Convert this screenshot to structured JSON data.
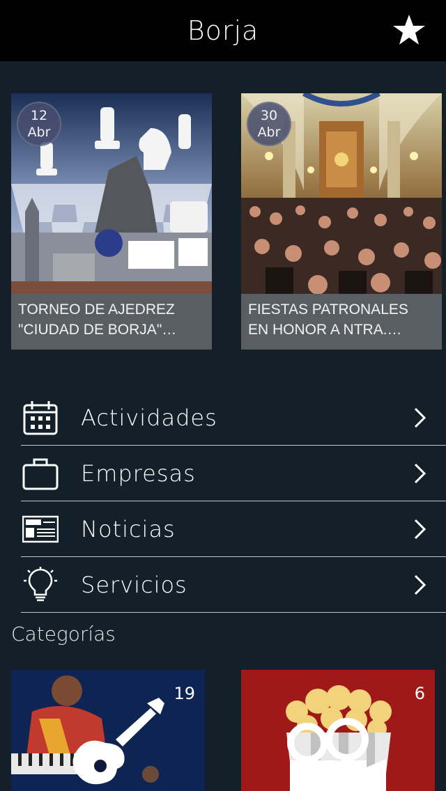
{
  "header": {
    "title": "Borja",
    "favorite_icon": "star-icon"
  },
  "events": [
    {
      "day": "12",
      "month": "Abr",
      "title": "TORNEO DE AJEDREZ\n\"CIUDAD DE BORJA\"…"
    },
    {
      "day": "30",
      "month": "Abr",
      "title": "FIESTAS PATRONALES\nEN HONOR A NTRA.…"
    }
  ],
  "menu": [
    {
      "label": "Actividades",
      "icon": "calendar-icon"
    },
    {
      "label": "Empresas",
      "icon": "briefcase-icon"
    },
    {
      "label": "Noticias",
      "icon": "newspaper-icon"
    },
    {
      "label": "Servicios",
      "icon": "lightbulb-icon"
    }
  ],
  "categories_title": "Categorías",
  "categories": [
    {
      "count": "19",
      "icon": "guitar-icon"
    },
    {
      "count": "6",
      "icon": "movie-camera-icon"
    }
  ],
  "colors": {
    "header_bg": "#000000",
    "page_bg": "#13202a",
    "card_caption_bg": "#595e62",
    "divider": "#c5c9cc"
  }
}
